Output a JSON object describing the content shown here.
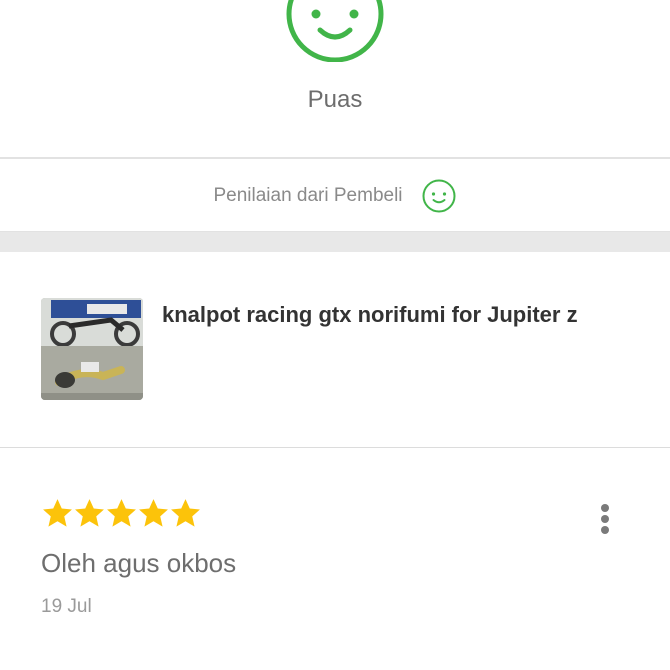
{
  "satisfaction": {
    "label": "Puas",
    "icon": "smiley-icon",
    "color": "#41b549"
  },
  "buyer_rating": {
    "label": "Penilaian dari Pembeli",
    "icon": "smiley-icon"
  },
  "product": {
    "title": "knalpot racing gtx norifumi for Jupiter z",
    "thumbnail_icon": "motorcycle-exhaust-photo"
  },
  "review": {
    "rating": 5,
    "max_rating": 5,
    "star_color": "#fcc30a",
    "reviewer": "Oleh agus okbos",
    "date": "19 Jul",
    "menu_icon": "more-vertical-icon"
  }
}
